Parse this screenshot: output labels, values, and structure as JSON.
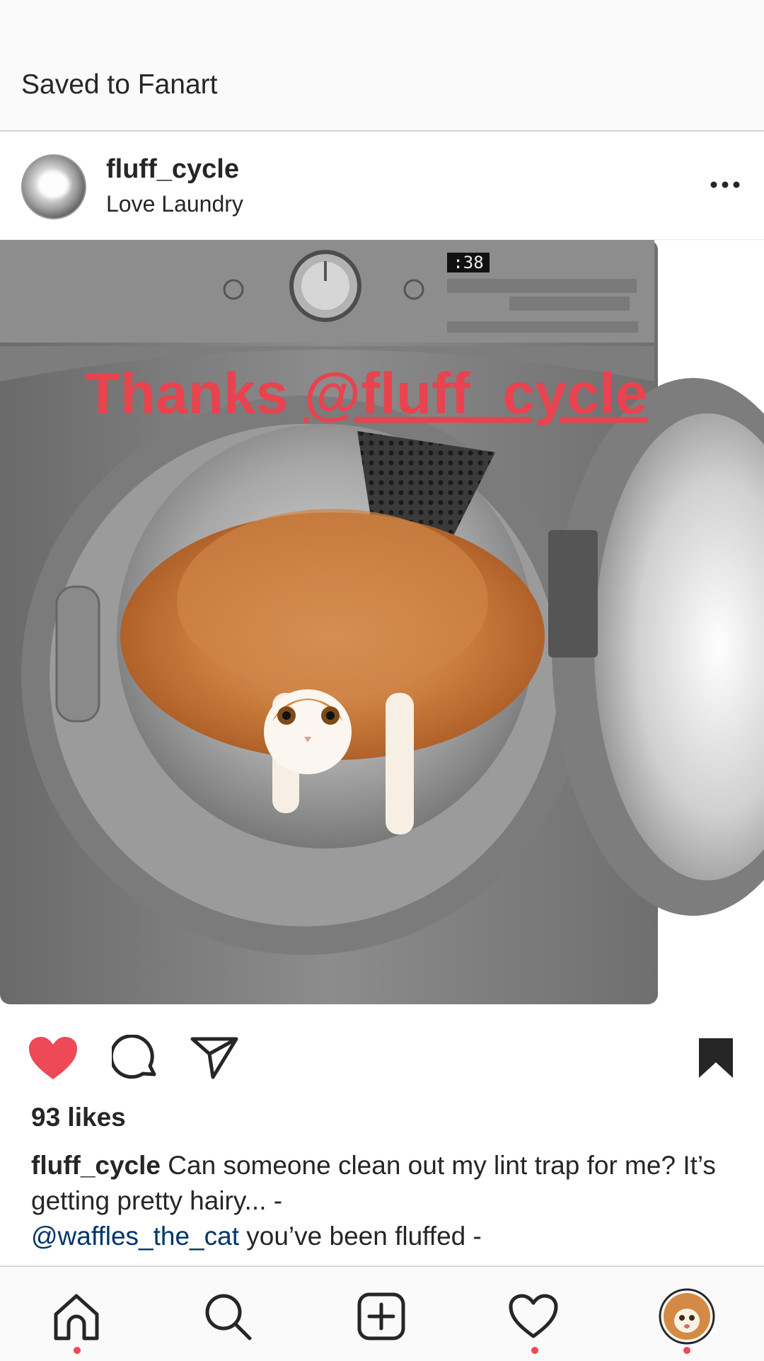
{
  "topbar": {
    "title": "Saved to Fanart"
  },
  "post": {
    "username": "fluff_cycle",
    "location": "Love Laundry",
    "media": {
      "overlay_text_plain": "Thanks ",
      "overlay_text_link": "@fluff_cycle",
      "display_time": ":38",
      "description": "cat wearing lion mane wig inside open dryer"
    },
    "likes": "93 likes",
    "caption": {
      "user": "fluff_cycle",
      "text": " Can someone clean out my lint trap for me? It’s getting pretty hairy... -",
      "mention": "@waffles_the_cat",
      "text2": " you’ve been fluffed -"
    },
    "liked": true,
    "saved": true
  },
  "icons": {
    "like": "heart-filled-icon",
    "comment": "comment-icon",
    "share": "paper-plane-icon",
    "save": "bookmark-filled-icon",
    "more": "more-horizontal-icon"
  },
  "nav": [
    {
      "name": "home-icon",
      "active_dot": true
    },
    {
      "name": "search-icon",
      "active_dot": false
    },
    {
      "name": "add-post-icon",
      "active_dot": false
    },
    {
      "name": "activity-heart-icon",
      "active_dot": true
    },
    {
      "name": "profile-avatar",
      "active_dot": true
    }
  ],
  "colors": {
    "like_red": "#ed4956",
    "overlay_red": "#e8434f",
    "mention_blue": "#003569",
    "text": "#262626"
  }
}
